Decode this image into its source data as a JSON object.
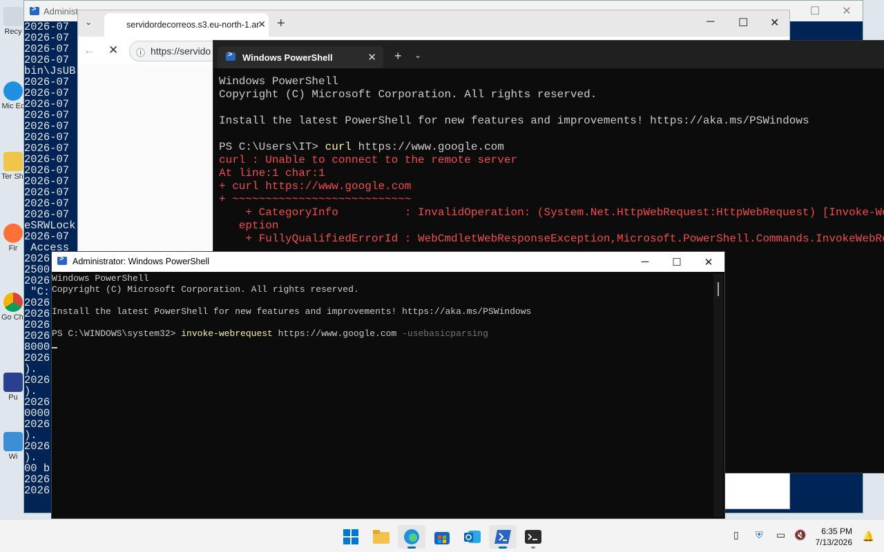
{
  "desktop": {
    "icons": [
      {
        "label": "Recy"
      },
      {
        "label": "Mic Ec"
      },
      {
        "label": "Ter Sho"
      },
      {
        "label": "Fir"
      },
      {
        "label": "Go Chr"
      },
      {
        "label": "Pu"
      },
      {
        "label": "Wi"
      }
    ]
  },
  "bg_console": {
    "title": "Administ",
    "lines": [
      "2026-07",
      "2026-07",
      "2026-07",
      "2026-07",
      "bin\\JsUB",
      "2026-07",
      "2026-07",
      "2026-07",
      "2026-07",
      "2026-07",
      "2026-07",
      "2026-07",
      "2026-07",
      "2026-07",
      "2026-07",
      "2026-07",
      "2026-07",
      "2026-07",
      "eSRWLock",
      "2026-07",
      " Access",
      "2026",
      "2500",
      "2026",
      " \"C:",
      "2026",
      "2026",
      "2026",
      "2026",
      "8000",
      "2026",
      ").",
      "2026",
      ").",
      "2026",
      "0000",
      "2026",
      ").",
      "2026",
      ").",
      "00 b",
      "2026",
      "2026"
    ]
  },
  "browser": {
    "tab_title": "servidordecorreos.s3.eu-north-1.ar",
    "address": "https://servido"
  },
  "terminal": {
    "tab_title": "Windows PowerShell",
    "lines": {
      "l1": "Windows PowerShell",
      "l2": "Copyright (C) Microsoft Corporation. All rights reserved.",
      "l3": "Install the latest PowerShell for new features and improvements! https://aka.ms/PSWindows",
      "prompt": "PS C:\\Users\\IT> ",
      "cmd": "curl",
      "arg": " https://www.google.com",
      "e1": "curl : Unable to connect to the remote server",
      "e2": "At line:1 char:1",
      "e3": "+ curl https://www.google.com",
      "e4": "+ ~~~~~~~~~~~~~~~~~~~~~~~~~~~",
      "e5": "    + CategoryInfo          : InvalidOperation: (System.Net.HttpWebRequest:HttpWebRequest) [Invoke-WebReque",
      "e6": "   eption",
      "e7": "    + FullyQualifiedErrorId : WebCmdletWebResponseException,Microsoft.PowerShell.Commands.InvokeWebRequestC"
    }
  },
  "admin": {
    "title": "Administrator: Windows PowerShell",
    "lines": {
      "l1": "Windows PowerShell",
      "l2": "Copyright (C) Microsoft Corporation. All rights reserved.",
      "l3": "Install the latest PowerShell for new features and improvements! https://aka.ms/PSWindows",
      "prompt": "PS C:\\WINDOWS\\system32> ",
      "cmd": "invoke-webrequest",
      "arg": " https://www.google.com ",
      "param": "-usebasicparsing"
    }
  },
  "taskbar": {
    "time": "6:35 PM",
    "date": "7/13/2026"
  }
}
